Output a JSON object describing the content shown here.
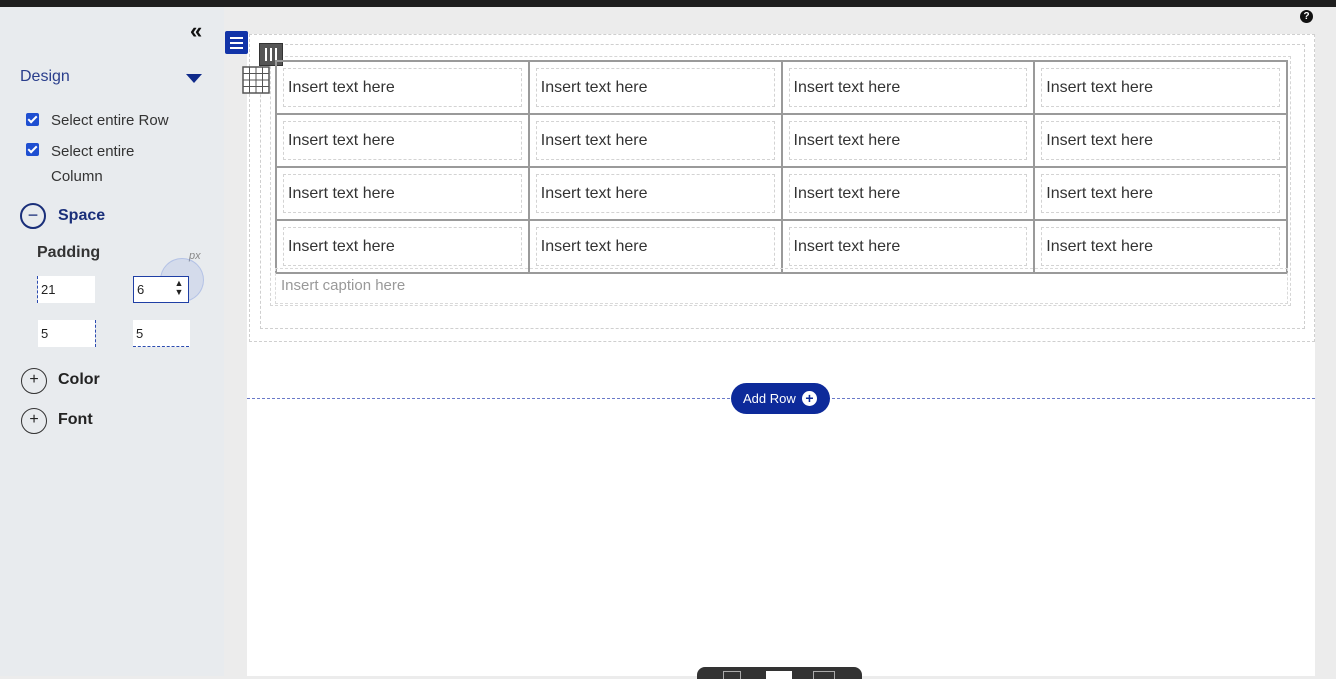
{
  "sidebar": {
    "collapse_glyph": "«",
    "design_title": "Design",
    "select_row_label": "Select entire Row",
    "select_column_label": "Select entire\nColumn",
    "space": {
      "label": "Space",
      "icon": "minus-circle-icon"
    },
    "padding": {
      "label": "Padding",
      "unit": "px",
      "top": "21",
      "right": "6",
      "bottom": "5",
      "left": "5"
    },
    "color": {
      "label": "Color",
      "icon": "plus-circle-icon"
    },
    "font": {
      "label": "Font",
      "icon": "plus-circle-icon"
    }
  },
  "table": {
    "rows": [
      [
        "Insert text here",
        "Insert text here",
        "Insert text here",
        "Insert text here"
      ],
      [
        "Insert text here",
        "Insert text here",
        "Insert text here",
        "Insert text here"
      ],
      [
        "Insert text here",
        "Insert text here",
        "Insert text here",
        "Insert text here"
      ],
      [
        "Insert text here",
        "Insert text here",
        "Insert text here",
        "Insert text here"
      ]
    ],
    "caption_placeholder": "Insert caption here"
  },
  "add_row": {
    "label": "Add Row"
  },
  "help_glyph": "?",
  "colors": {
    "accent": "#0d2a9a",
    "link": "#2a3e8c",
    "checkbox": "#1f4fd1"
  }
}
